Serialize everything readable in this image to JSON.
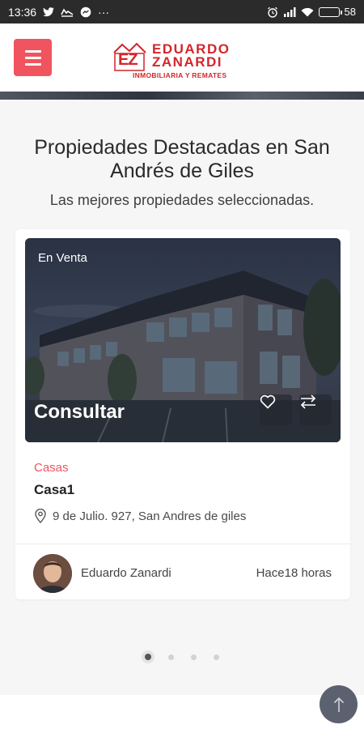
{
  "status_bar": {
    "time": "13:36",
    "dots": "···",
    "battery": "58",
    "battery_level": 0.58
  },
  "header": {
    "logo": {
      "mark": "EZ",
      "name_line1": "EDUARDO",
      "name_line2": "ZANARDI",
      "tagline": "INMOBILIARIA Y REMATES"
    }
  },
  "section": {
    "title": "Propiedades Destacadas en San Andrés de Giles",
    "subtitle": "Las mejores propiedades seleccionadas."
  },
  "card": {
    "tag": "En Venta",
    "price": "Consultar",
    "category": "Casas",
    "title": "Casa1",
    "address": "9 de Julio. 927, San Andres de giles",
    "agent_name": "Eduardo Zanardi",
    "time_ago": "Hace18 horas"
  },
  "carousel": {
    "count": 4,
    "active": 1
  },
  "colors": {
    "accent": "#f0545f",
    "brand_red": "#d3262b",
    "status_bar": "#2b2b2b",
    "section_bg": "#f6f6f6",
    "to_top_button": "#5c6170"
  },
  "icons": [
    "menu-icon",
    "heart-icon",
    "compare-arrows-icon",
    "location-pin-icon",
    "arrow-up-icon"
  ]
}
